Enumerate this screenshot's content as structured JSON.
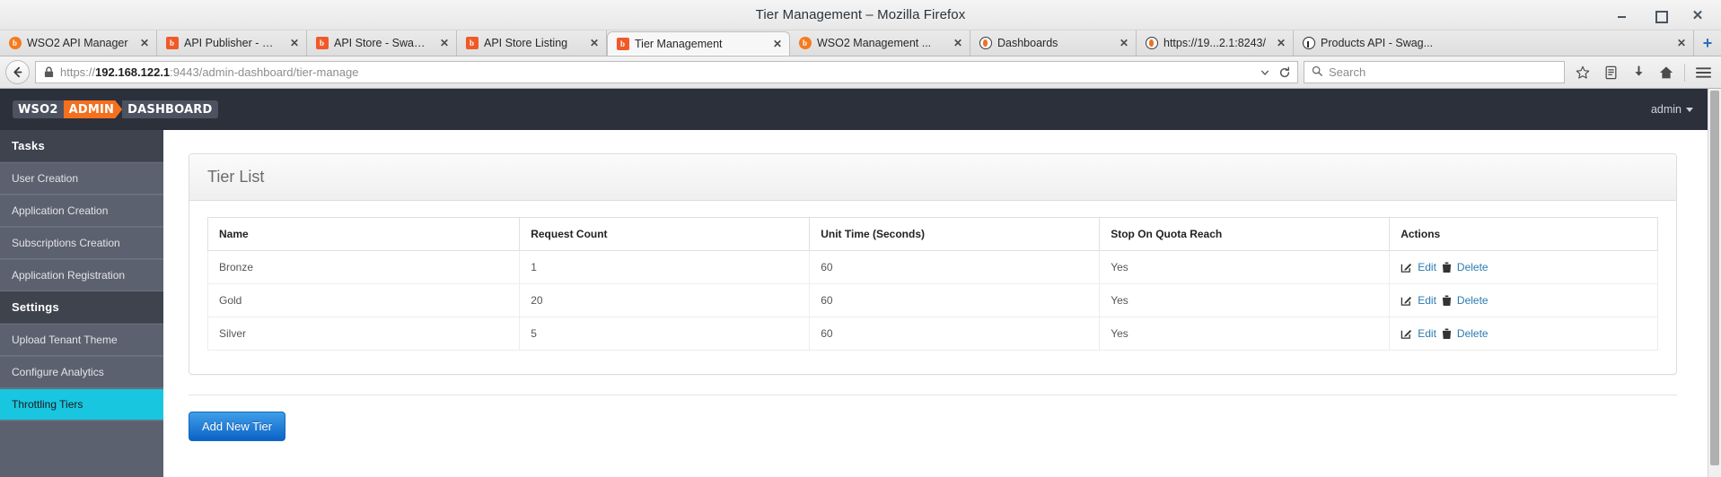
{
  "window": {
    "title": "Tier Management – Mozilla Firefox",
    "controls": {
      "minimize": "–",
      "maximize": "□",
      "close": "✕"
    }
  },
  "tabs": [
    {
      "label": "WSO2 API Manager",
      "icon": "wso2-circle-icon",
      "close": "✕",
      "active": false
    },
    {
      "label": "API Publisher - Mana...",
      "icon": "wso2-square-icon",
      "close": "✕",
      "active": false
    },
    {
      "label": "API Store - Swagger...",
      "icon": "wso2-square-icon",
      "close": "✕",
      "active": false
    },
    {
      "label": "API Store Listing",
      "icon": "wso2-square-icon",
      "close": "✕",
      "active": false
    },
    {
      "label": "Tier Management",
      "icon": "wso2-square-icon",
      "close": "✕",
      "active": true
    },
    {
      "label": "WSO2 Management ...",
      "icon": "wso2-circle-icon",
      "close": "✕",
      "active": false
    },
    {
      "label": "Dashboards",
      "icon": "flame-icon",
      "close": "✕",
      "active": false
    },
    {
      "label": "https://19...2.1:8243/",
      "icon": "flame-icon",
      "close": "✕",
      "active": false
    },
    {
      "label": "Products API - Swag...",
      "icon": "github-icon",
      "close": "✕",
      "active": false
    }
  ],
  "newtab_label": "+",
  "navbar": {
    "back_icon": "back-arrow-icon",
    "lock_icon": "lock-icon",
    "url_prefix": "https://",
    "url_host": "192.168.122.1",
    "url_suffix": ":9443/admin-dashboard/tier-manage",
    "url_full": "https://192.168.122.1:9443/admin-dashboard/tier-manage",
    "dropdown_icon": "chevron-down-icon",
    "reload_icon": "reload-icon",
    "search_placeholder": "Search",
    "search_icon": "search-icon",
    "bookmark_icon": "star-icon",
    "library_icon": "library-icon",
    "downloads_icon": "download-icon",
    "home_icon": "home-icon",
    "menu_icon": "hamburger-menu-icon"
  },
  "app": {
    "logo": {
      "part1": "WSO2",
      "part2": "ADMIN",
      "part3": "DASHBOARD"
    },
    "user": "admin",
    "accent_orange": "#f4701f",
    "header_bg": "#2b303b",
    "sidebar_bg": "#5b616e",
    "sidebar_active_bg": "#18c6e0"
  },
  "sidebar": {
    "groups": [
      {
        "heading": "Tasks",
        "items": [
          {
            "label": "User Creation",
            "active": false
          },
          {
            "label": "Application Creation",
            "active": false
          },
          {
            "label": "Subscriptions Creation",
            "active": false
          },
          {
            "label": "Application Registration",
            "active": false
          }
        ]
      },
      {
        "heading": "Settings",
        "items": [
          {
            "label": "Upload Tenant Theme",
            "active": false
          },
          {
            "label": "Configure Analytics",
            "active": false
          },
          {
            "label": "Throttling Tiers",
            "active": true
          }
        ]
      }
    ]
  },
  "main": {
    "panel_title": "Tier List",
    "table": {
      "columns": [
        "Name",
        "Request Count",
        "Unit Time (Seconds)",
        "Stop On Quota Reach",
        "Actions"
      ],
      "rows": [
        {
          "name": "Bronze",
          "request_count": "1",
          "unit_time": "60",
          "stop_on_quota": "Yes",
          "edit": "Edit",
          "delete": "Delete"
        },
        {
          "name": "Gold",
          "request_count": "20",
          "unit_time": "60",
          "stop_on_quota": "Yes",
          "edit": "Edit",
          "delete": "Delete"
        },
        {
          "name": "Silver",
          "request_count": "5",
          "unit_time": "60",
          "stop_on_quota": "Yes",
          "edit": "Edit",
          "delete": "Delete"
        }
      ]
    },
    "add_button": "Add New Tier"
  }
}
